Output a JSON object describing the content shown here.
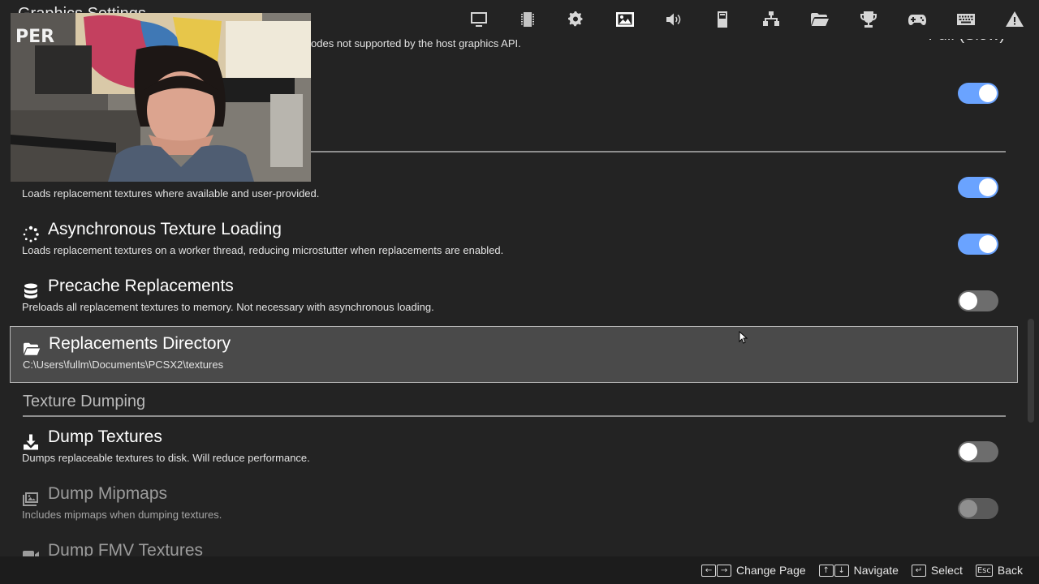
{
  "header": {
    "title": "Graphics Settings",
    "nav_icons": [
      "monitor-icon",
      "chip-icon",
      "gears-icon",
      "image-icon",
      "speaker-icon",
      "memory-card-icon",
      "network-icon",
      "folder-icon",
      "trophy-icon",
      "gamepad-icon",
      "keyboard-icon",
      "warning-icon"
    ],
    "active_icon": "image-icon"
  },
  "top_partial": {
    "desc": "odes not supported by the host graphics API.",
    "value": "Full (Slow)"
  },
  "settings": {
    "load_textures": {
      "desc": "Loads replacement textures where available and user-provided.",
      "enabled": true
    },
    "async_loading": {
      "title": "Asynchronous Texture Loading",
      "desc": "Loads replacement textures on a worker thread, reducing microstutter when replacements are enabled.",
      "enabled": true
    },
    "precache": {
      "title": "Precache Replacements",
      "desc": "Preloads all replacement textures to memory. Not necessary with asynchronous loading.",
      "enabled": false
    },
    "replacements_dir": {
      "title": "Replacements Directory",
      "path": "C:\\Users\\fullm\\Documents\\PCSX2\\textures"
    },
    "dumping_section": "Texture Dumping",
    "dump_textures": {
      "title": "Dump Textures",
      "desc": "Dumps replaceable textures to disk. Will reduce performance.",
      "enabled": false
    },
    "dump_mipmaps": {
      "title": "Dump Mipmaps",
      "desc": "Includes mipmaps when dumping textures.",
      "enabled": false
    },
    "dump_fmv": {
      "title": "Dump FMV Textures"
    }
  },
  "footer": {
    "hints": [
      {
        "keys": [
          "←",
          "→"
        ],
        "label": "Change Page"
      },
      {
        "keys": [
          "↑",
          "↓"
        ],
        "label": "Navigate"
      },
      {
        "keys": [
          "↵"
        ],
        "label": "Select"
      },
      {
        "keys": [
          "Esc"
        ],
        "label": "Back"
      }
    ]
  },
  "colors": {
    "accent": "#6aa3ff",
    "background": "#232323",
    "selected_row": "#4a4a4a"
  }
}
